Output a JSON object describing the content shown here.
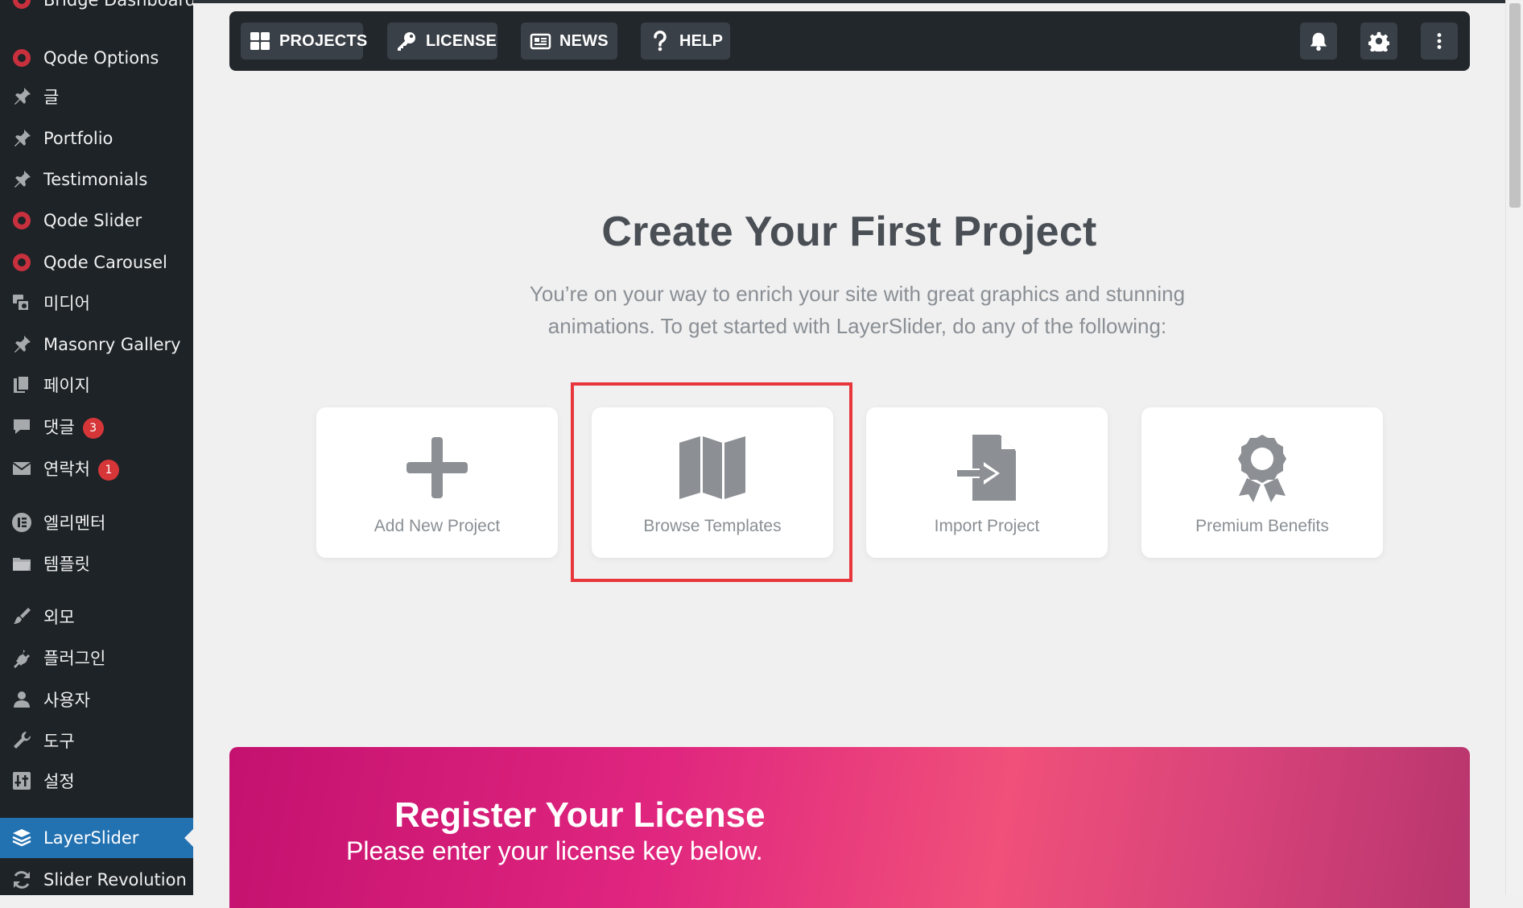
{
  "sidebar": {
    "items": [
      {
        "label": "Bridge Dashboard",
        "icon": "bridge-circle-icon",
        "badge": null
      },
      {
        "label": "Qode Options",
        "icon": "qode-circle-icon",
        "badge": null
      },
      {
        "label": "글",
        "icon": "pin-icon",
        "badge": null
      },
      {
        "label": "Portfolio",
        "icon": "pin-icon",
        "badge": null
      },
      {
        "label": "Testimonials",
        "icon": "pin-icon",
        "badge": null
      },
      {
        "label": "Qode Slider",
        "icon": "qode-circle-icon",
        "badge": null
      },
      {
        "label": "Qode Carousel",
        "icon": "qode-circle-icon",
        "badge": null
      },
      {
        "label": "미디어",
        "icon": "media-icon",
        "badge": null
      },
      {
        "label": "Masonry Gallery",
        "icon": "pin-icon",
        "badge": null
      },
      {
        "label": "페이지",
        "icon": "pages-icon",
        "badge": null
      },
      {
        "label": "댓글",
        "icon": "comment-icon",
        "badge": "3"
      },
      {
        "label": "연락처",
        "icon": "mail-icon",
        "badge": "1"
      },
      {
        "label": "엘리멘터",
        "icon": "elementor-icon",
        "badge": null
      },
      {
        "label": "템플릿",
        "icon": "folder-icon",
        "badge": null
      },
      {
        "label": "외모",
        "icon": "brush-icon",
        "badge": null
      },
      {
        "label": "플러그인",
        "icon": "plugin-icon",
        "badge": null
      },
      {
        "label": "사용자",
        "icon": "user-icon",
        "badge": null
      },
      {
        "label": "도구",
        "icon": "wrench-icon",
        "badge": null
      },
      {
        "label": "설정",
        "icon": "settings-icon",
        "badge": null
      },
      {
        "label": "LayerSlider",
        "icon": "layers-icon",
        "badge": null,
        "active": true
      },
      {
        "label": "Slider Revolution",
        "icon": "refresh-icon",
        "badge": null
      }
    ]
  },
  "toolbar": {
    "projects_label": "PROJECTS",
    "license_label": "LICENSE",
    "news_label": "NEWS",
    "help_label": "HELP",
    "right_icons": [
      "bell-icon",
      "gear-icon",
      "more-vertical-icon"
    ]
  },
  "main": {
    "heading": "Create Your First Project",
    "subtext": "You’re on your way to enrich your site with great graphics and stunning animations. To get started with LayerSlider, do any of the following:",
    "cards": [
      {
        "label": "Add New Project",
        "icon": "plus-icon"
      },
      {
        "label": "Browse Templates",
        "icon": "map-icon",
        "highlighted": true
      },
      {
        "label": "Import Project",
        "icon": "import-file-icon"
      },
      {
        "label": "Premium Benefits",
        "icon": "award-icon"
      }
    ]
  },
  "banner": {
    "title": "Register Your License",
    "subtitle": "Please enter your license key below."
  },
  "colors": {
    "sidebar_bg": "#1d2327",
    "active_item": "#2271b1",
    "toolbar_bg": "#22272c",
    "highlight_border": "#e8373c",
    "badge": "#d63638"
  }
}
